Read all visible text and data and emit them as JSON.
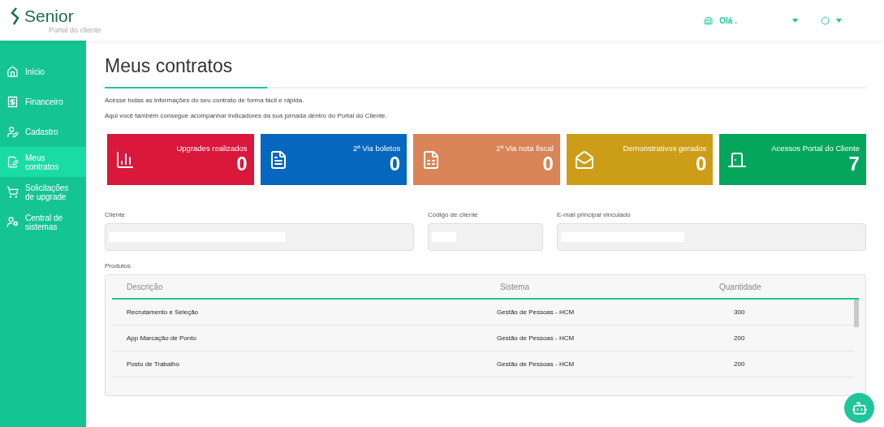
{
  "brand": {
    "name": "Senior",
    "subtitle": "Portal do cliente"
  },
  "header": {
    "greeting": "Olá ."
  },
  "sidebar": {
    "items": [
      {
        "label": "Início",
        "selected": false
      },
      {
        "label": "Financeiro",
        "selected": false
      },
      {
        "label": "Cadastro",
        "selected": false
      },
      {
        "label": "Meus contratos",
        "selected": true
      },
      {
        "label": "Solicitações de upgrade",
        "selected": false
      },
      {
        "label": "Central de sistemas",
        "selected": false
      }
    ]
  },
  "page": {
    "title": "Meus contratos",
    "intro": [
      "Acesse todas as informações do seu contrato de forma fácil e rápida.",
      "Aqui você também consegue acompanhar indicadores da sua jornada dentro do Portal do Cliente."
    ]
  },
  "stats": [
    {
      "label": "Upgrades realizados",
      "value": "0",
      "color": "#d9183b"
    },
    {
      "label": "2ª Via boletos",
      "value": "0",
      "color": "#0567be"
    },
    {
      "label": "2ª Via nota fiscal",
      "value": "0",
      "color": "#d98558"
    },
    {
      "label": "Demonstrativos gerados",
      "value": "0",
      "color": "#cc9e17"
    },
    {
      "label": "Acessos Portal do Cliente",
      "value": "7",
      "color": "#04a65c"
    }
  ],
  "fields": [
    {
      "label": "Cliente"
    },
    {
      "label": "Código de cliente"
    },
    {
      "label": "E-mail principal vinculado"
    }
  ],
  "products": {
    "label": "Produtos",
    "columns": [
      "Descrição",
      "Sistema",
      "Quantidade"
    ],
    "rows": [
      [
        "Recrutamento e Seleção",
        "Gestão de Pessoas - HCM",
        "300"
      ],
      [
        "App Marcação de Ponto",
        "Gestão de Pessoas - HCM",
        "200"
      ],
      [
        "Posto de Trabalho",
        "Gestão de Pessoas - HCM",
        "200"
      ]
    ]
  }
}
